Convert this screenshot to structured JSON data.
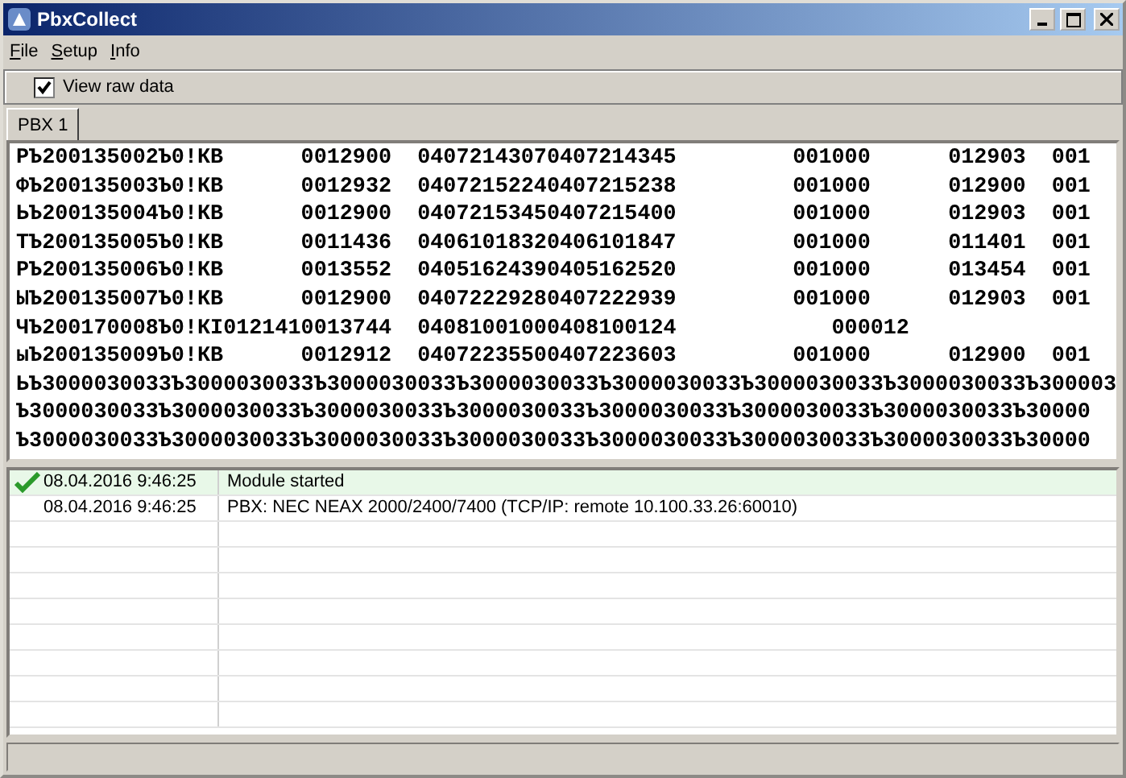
{
  "window": {
    "title": "PbxCollect"
  },
  "menu": [
    "File",
    "Setup",
    "Info"
  ],
  "toolbar": {
    "view_raw_data": {
      "label": "View raw data",
      "checked": true
    }
  },
  "tabs": [
    {
      "label": "PBX 1",
      "selected": true
    }
  ],
  "raw_data": [
    "РЪ200135002Ъ0!КВ      0012900  04072143070407214345         001000      012903  001",
    "ФЪ200135003Ъ0!КВ      0012932  04072152240407215238         001000      012900  001",
    "ЬЪ200135004Ъ0!КВ      0012900  04072153450407215400         001000      012903  001",
    "ТЪ200135005Ъ0!КВ      0011436  04061018320406101847         001000      011401  001",
    "РЪ200135006Ъ0!КВ      0013552  04051624390405162520         001000      013454  001",
    "ЫЪ200135007Ъ0!КВ      0012900  04072229280407222939         001000      012903  001",
    "ЧЪ200170008Ъ0!КI0121410013744  04081001000408100124            000012",
    "ыЪ200135009Ъ0!КВ      0012912  04072235500407223603         001000      012900  001",
    "ЬЪ3000030033Ъ3000030033Ъ3000030033Ъ3000030033Ъ3000030033Ъ3000030033Ъ3000030033Ъ300003",
    "Ъ3000030033Ъ3000030033Ъ3000030033Ъ3000030033Ъ3000030033Ъ3000030033Ъ3000030033Ъ30000",
    "Ъ3000030033Ъ3000030033Ъ3000030033Ъ3000030033Ъ3000030033Ъ3000030033Ъ3000030033Ъ30000"
  ],
  "log": [
    {
      "kind": "success",
      "time": "08.04.2016 9:46:25",
      "message": "Module started"
    },
    {
      "kind": "info",
      "time": "08.04.2016 9:46:25",
      "message": "PBX: NEC NEAX 2000/2400/7400 (TCP/IP: remote 10.100.33.26:60010)"
    }
  ]
}
